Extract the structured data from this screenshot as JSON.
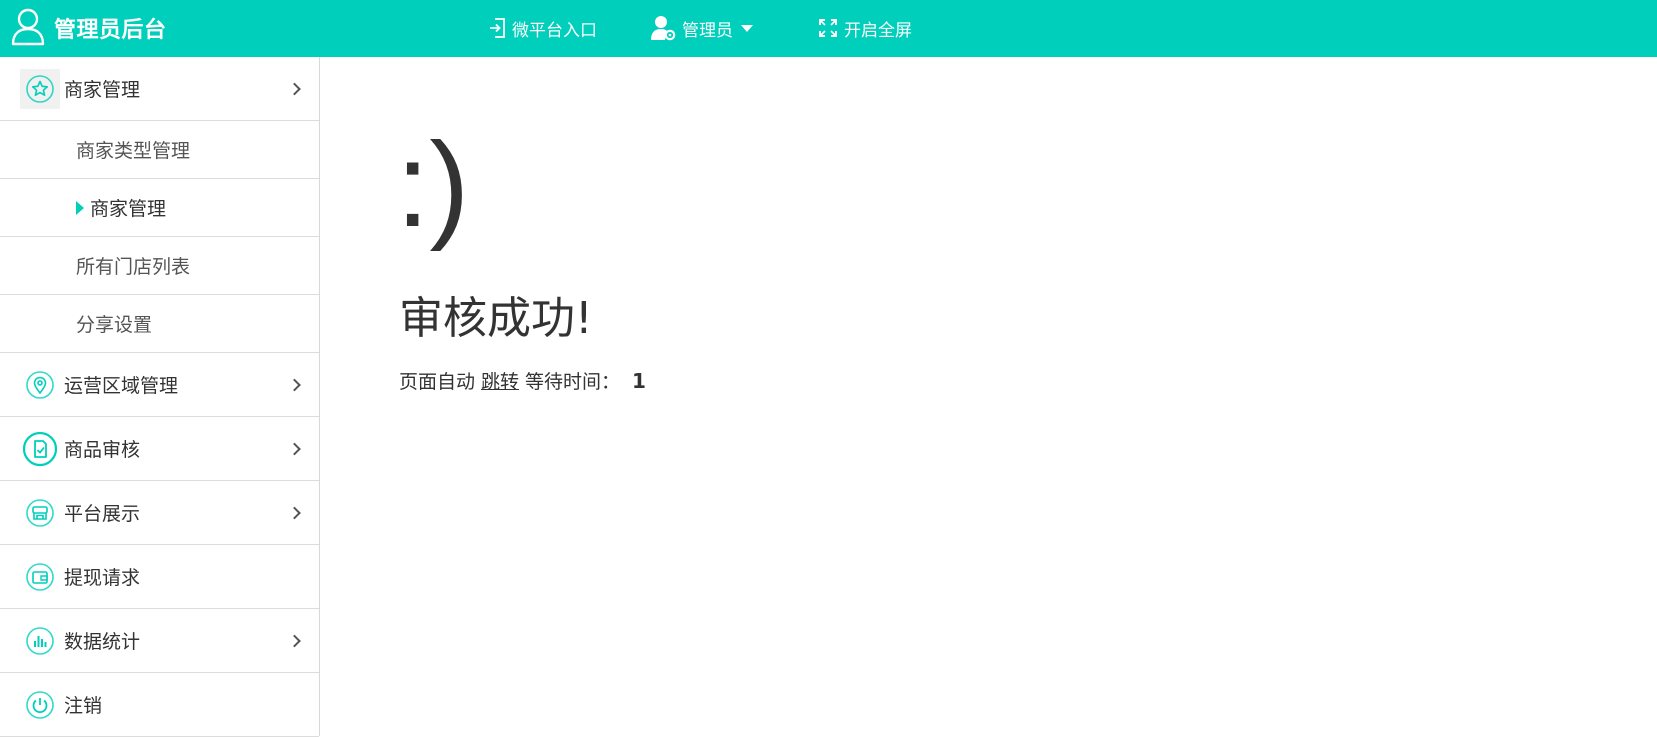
{
  "header": {
    "brand_title": "管理员后台",
    "brand_icon": "user-outline-icon",
    "nav": [
      {
        "label": "微平台入口",
        "icon": "enter-icon"
      },
      {
        "label": "管理员",
        "icon": "user-gear-icon"
      },
      {
        "label": "开启全屏",
        "icon": "fullscreen-icon"
      }
    ]
  },
  "sidebar": {
    "items": [
      {
        "label": "商家管理",
        "icon": "star-circle-icon",
        "expanded": true,
        "children": [
          {
            "label": "商家类型管理"
          },
          {
            "label": "商家管理",
            "active": true
          },
          {
            "label": "所有门店列表"
          },
          {
            "label": "分享设置"
          }
        ]
      },
      {
        "label": "运营区域管理",
        "icon": "location-pin-icon"
      },
      {
        "label": "商品审核",
        "icon": "document-check-icon"
      },
      {
        "label": "平台展示",
        "icon": "storefront-icon"
      },
      {
        "label": "提现请求",
        "icon": "wallet-icon"
      },
      {
        "label": "数据统计",
        "icon": "bar-chart-icon"
      },
      {
        "label": "注销",
        "icon": "power-icon"
      }
    ]
  },
  "main": {
    "face": ":)",
    "title": "审核成功!",
    "prefix": "页面自动",
    "link": "跳转",
    "wait_label": "等待时间：",
    "countdown": "1"
  },
  "colors": {
    "accent": "#00cfbb",
    "text": "#333333",
    "border": "#dcdcdc"
  }
}
